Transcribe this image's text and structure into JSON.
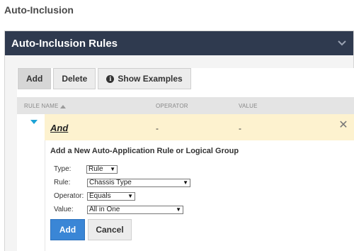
{
  "page": {
    "title": "Auto-Inclusion"
  },
  "panel": {
    "title": "Auto-Inclusion Rules",
    "collapse_icon": "chevron-down-icon"
  },
  "toolbar": {
    "add_label": "Add",
    "delete_label": "Delete",
    "examples_label": "Show Examples",
    "examples_icon": "info-icon"
  },
  "table": {
    "columns": [
      "RULE NAME",
      "OPERATOR",
      "VALUE"
    ],
    "sort_icon": "sort-ascending-icon",
    "rows": [
      {
        "name": "And",
        "operator": "-",
        "value": "-"
      }
    ]
  },
  "form": {
    "title": "Add a New Auto-Application Rule or Logical Group",
    "type_label": "Type:",
    "type_value": "Rule",
    "rule_label": "Rule:",
    "rule_value": "Chassis Type",
    "operator_label": "Operator:",
    "operator_value": "Equals",
    "value_label": "Value:",
    "value_value": "All in One",
    "add_label": "Add",
    "cancel_label": "Cancel"
  },
  "colors": {
    "header_bg": "#2f3a4f",
    "row_highlight": "#fdf2cf",
    "primary_button": "#3a86d6",
    "toggle": "#1ba3d6"
  }
}
